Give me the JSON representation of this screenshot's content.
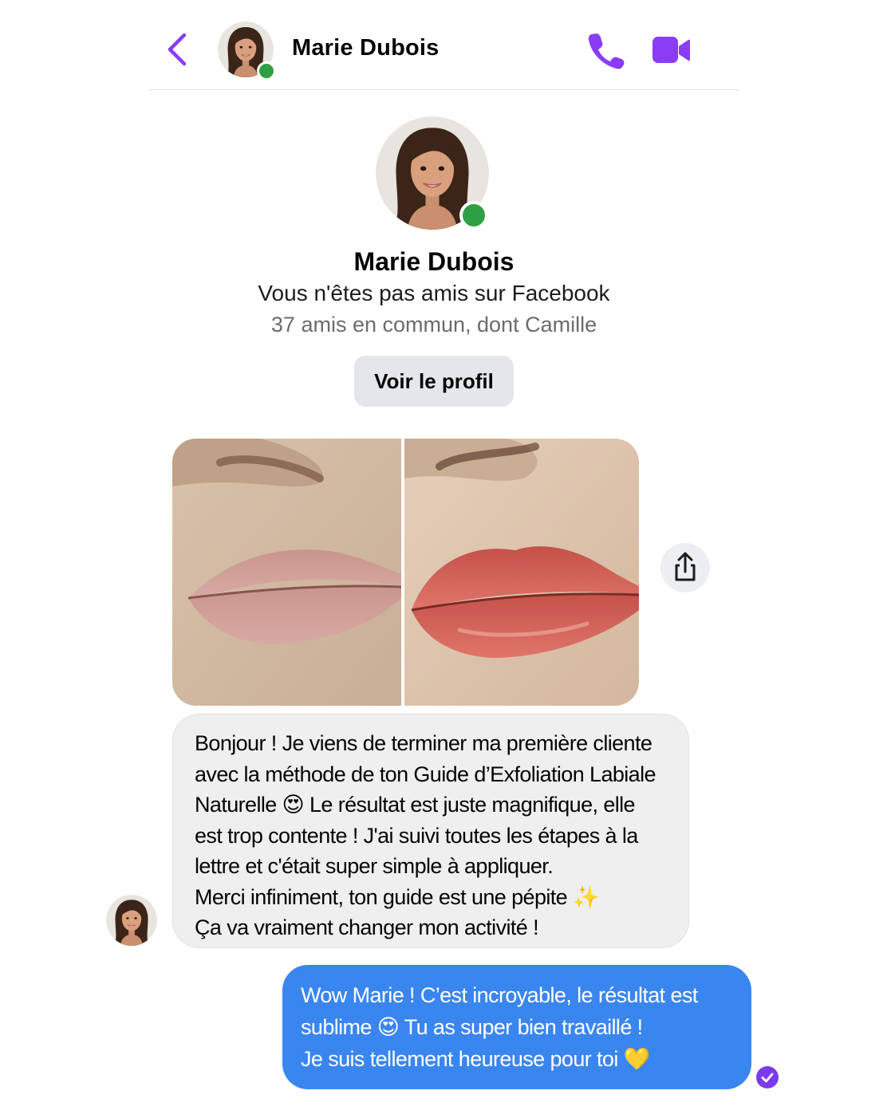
{
  "colors": {
    "accent": "#8b3cf7",
    "online": "#2ea043",
    "outgoing_bubble": "#3a86f0",
    "incoming_bubble": "#efefef",
    "button_bg": "#e4e6eb"
  },
  "header": {
    "contact_name": "Marie Dubois",
    "icons": [
      "back-arrow-icon",
      "phone-icon",
      "video-camera-icon"
    ]
  },
  "profile": {
    "name": "Marie Dubois",
    "subtitle": "Vous n'êtes pas amis sur Facebook",
    "mutual_friends": "37 amis en commun, dont Camille",
    "button_label": "Voir le profil"
  },
  "conversation": {
    "photo": "before-after lip comparison photo",
    "incoming_message": "Bonjour ! Je viens de terminer ma première cliente\navec la méthode de ton Guide d’Exfoliation Labiale\nNaturelle 😍 Le résultat est juste magnifique, elle\nest trop contente ! J'ai suivi toutes les étapes à la\nlettre et c'était super simple à appliquer.\nMerci infiniment, ton guide est une pépite ✨\nÇa va vraiment changer mon activité !",
    "outgoing_message": "Wow Marie ! C’est incroyable, le résultat est\nsublime 😍 Tu as super bien travaillé !\nJe suis tellement heureuse pour toi 💛"
  }
}
